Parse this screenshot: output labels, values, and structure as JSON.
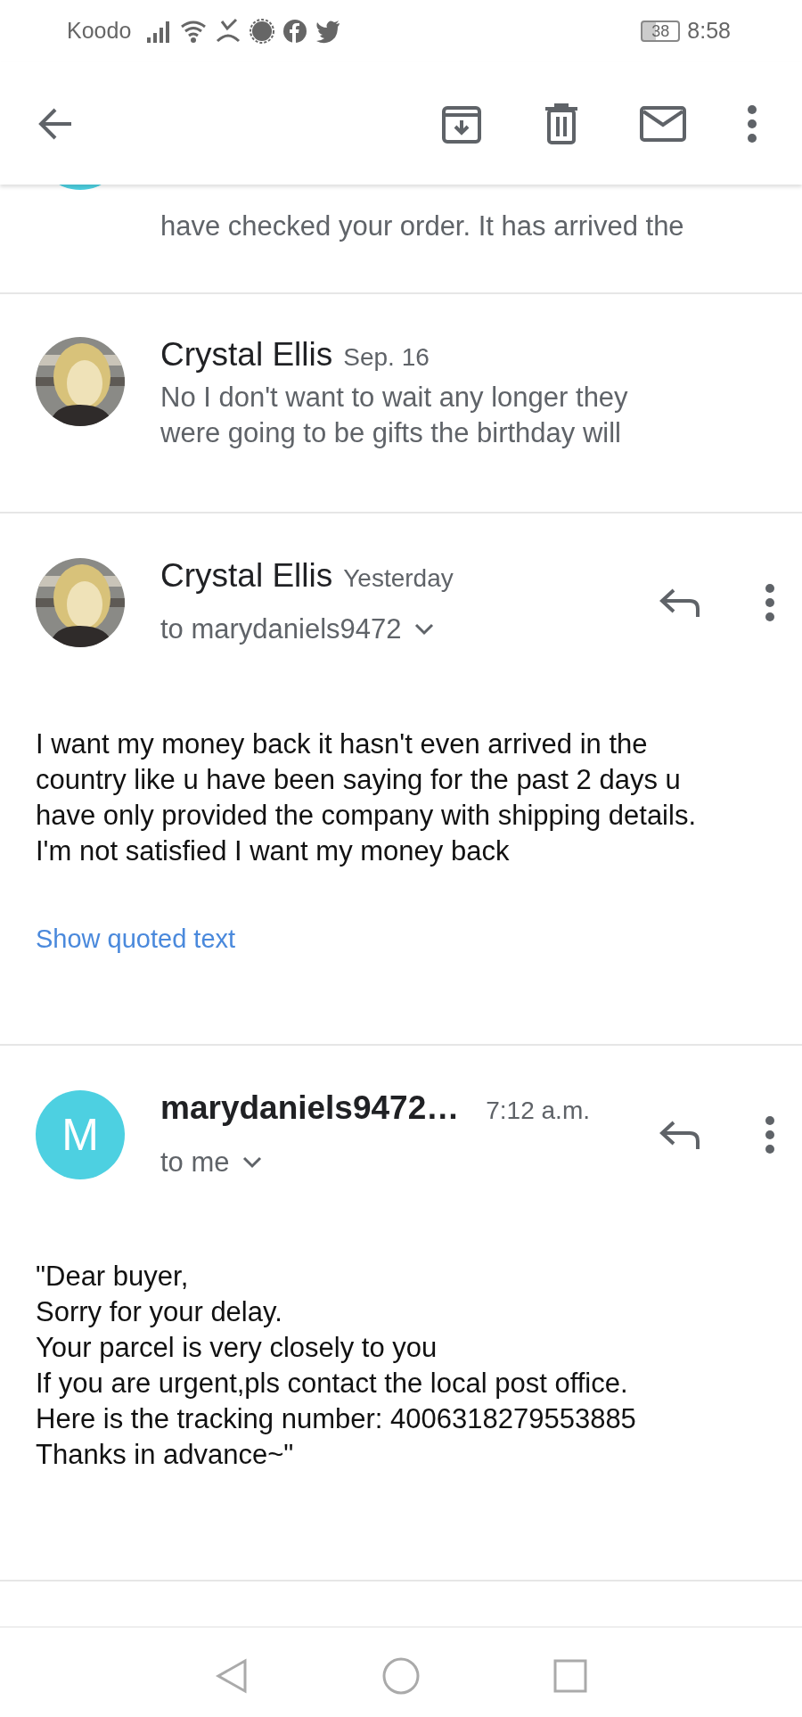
{
  "status_bar": {
    "carrier": "Koodo",
    "battery": "38",
    "time": "8:58"
  },
  "messages": [
    {
      "kind": "cutoff",
      "avatar": {
        "kind": "letter",
        "color": "#4dd0e1"
      },
      "snippet": "have checked your order. It has arrived the"
    },
    {
      "kind": "collapsed",
      "sender": "Crystal Ellis",
      "date": "Sep. 16",
      "snippet": "No I don't want to wait any longer they\nwere going to be gifts the birthday will"
    },
    {
      "kind": "expanded",
      "sender": "Crystal Ellis",
      "date": "Yesterday",
      "recipient": "to marydaniels9472",
      "body": "I want my money back it hasn't even arrived in the\ncountry like u have been saying for the past 2 days u\nhave only provided the company with shipping details.\nI'm not satisfied I want my money back",
      "quoted_link": "Show quoted text"
    },
    {
      "kind": "expanded",
      "avatar": {
        "kind": "letter",
        "letter": "M",
        "color": "#4dd0e1"
      },
      "sender": "marydaniels9472…",
      "date": "7:12 a.m.",
      "recipient": "to me",
      "body": "\"Dear buyer,\nSorry for your delay.\nYour parcel is very closely to you\nIf you are urgent,pls contact the local post office.\nHere is the tracking number: 4006318279553885\nThanks in advance~\""
    }
  ]
}
